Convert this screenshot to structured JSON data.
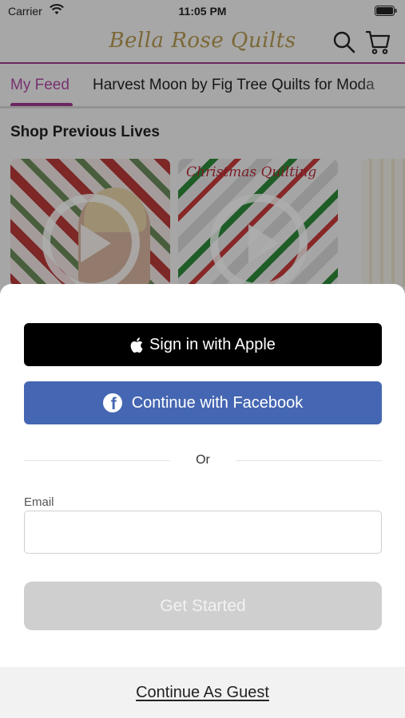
{
  "status_bar": {
    "carrier": "Carrier",
    "time": "11:05 PM"
  },
  "header": {
    "brand": "Bella Rose Quilts",
    "icons": [
      "search-icon",
      "cart-icon"
    ]
  },
  "tabs": [
    {
      "label": "My Feed",
      "active": true
    },
    {
      "label": "Harvest Moon by Fig Tree Quilts for Moda",
      "active": false
    }
  ],
  "section": {
    "title": "Shop Previous Lives",
    "thumb2_text": "Christmas Quilting"
  },
  "sheet": {
    "apple_label": "Sign in with Apple",
    "facebook_label": "Continue with Facebook",
    "or_label": "Or",
    "email_label": "Email",
    "email_value": "",
    "email_placeholder": "",
    "get_started_label": "Get Started",
    "guest_label": "Continue As Guest"
  },
  "colors": {
    "accent": "#a03a8e",
    "brand_gold": "#b59a52",
    "facebook_blue": "#4566b2",
    "apple_black": "#000000",
    "disabled_gray": "#cfcfcf"
  }
}
